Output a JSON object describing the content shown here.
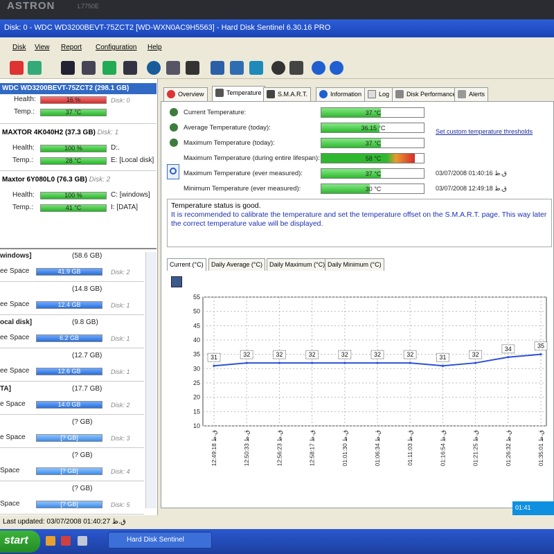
{
  "bezel": {
    "brand": "ASTRON",
    "model": "L7750E"
  },
  "window": {
    "title": "Disk: 0 - WDC WD3200BEVT-75ZCT2 [WD-WXN0AC9H5563] - Hard Disk Sentinel 6.30.16 PRO"
  },
  "menu": [
    "Disk",
    "View",
    "Report",
    "Configuration",
    "Help"
  ],
  "disks": [
    {
      "name": "WDC WD3200BEVT-75ZCT2",
      "size": "(298.1 GB)",
      "health_label": "Health:",
      "health": "16 %",
      "health_level": 0.16,
      "temp_label": "Temp.:",
      "temp": "37 °C",
      "disk": "Disk: 0",
      "drives": []
    },
    {
      "name": "MAXTOR 4K040H2",
      "size": "(37.3 GB)",
      "health_label": "Health:",
      "health": "100 %",
      "health_level": 1.0,
      "temp_label": "Temp.:",
      "temp": "28 °C",
      "disk": "Disk: 1",
      "drives": [
        "D:.",
        "E: [Local disk]"
      ]
    },
    {
      "name": "Maxtor 6Y080L0",
      "size": "(76.3 GB)",
      "health_label": "Health:",
      "health": "100 %",
      "health_level": 1.0,
      "temp_label": "Temp.:",
      "temp": "41 °C",
      "disk": "Disk: 2",
      "drives": [
        "C: [windows]",
        "I: [DATA]"
      ]
    }
  ],
  "volumes": [
    {
      "name": "windows]",
      "size": "(58.6 GB)",
      "free_label": "ee Space",
      "free": "41.9 GB",
      "disk": "Disk: 2"
    },
    {
      "name": "",
      "size": "(14.8 GB)",
      "free_label": "ee Space",
      "free": "12.4 GB",
      "disk": "Disk: 1"
    },
    {
      "name": "ocal disk]",
      "size": "(9.8 GB)",
      "free_label": "ee Space",
      "free": "6.2 GB",
      "disk": "Disk: 1"
    },
    {
      "name": "",
      "size": "(12.7 GB)",
      "free_label": "ee Space",
      "free": "12.6 GB",
      "disk": "Disk: 1"
    },
    {
      "name": "TA]",
      "size": "(17.7 GB)",
      "free_label": "e Space",
      "free": "14.0 GB",
      "disk": "Disk: 2"
    },
    {
      "name": "",
      "size": "(? GB)",
      "free_label": "e Space",
      "free": "[? GB]",
      "disk": "Disk: 3"
    },
    {
      "name": "",
      "size": "(? GB)",
      "free_label": "Space",
      "free": "[? GB]",
      "disk": "Disk: 4"
    },
    {
      "name": "",
      "size": "(? GB)",
      "free_label": "Space",
      "free": "[? GB]",
      "disk": "Disk: 5"
    }
  ],
  "tabs": [
    "Overview",
    "Temperature",
    "S.M.A.R.T.",
    "Information",
    "Log",
    "Disk Performance",
    "Alerts"
  ],
  "temps": [
    {
      "label": "Current Temperature:",
      "value": "37 °C",
      "level": 0.37,
      "stamp": ""
    },
    {
      "label": "Average Temperature (today):",
      "value": "36.15 °C",
      "level": 0.36,
      "stamp": ""
    },
    {
      "label": "Maximum Temperature (today):",
      "value": "37 °C",
      "level": 0.37,
      "stamp": ""
    },
    {
      "label": "Maximum Temperature (during entire lifespan):",
      "value": "58 °C",
      "level": 0.58,
      "stamp": ""
    },
    {
      "label": "Maximum Temperature (ever measured):",
      "value": "37 °C",
      "level": 0.37,
      "stamp": "03/07/2008 01:40:16 ق.ظ"
    },
    {
      "label": "Minimum Temperature (ever measured):",
      "value": "30 °C",
      "level": 0.3,
      "stamp": "03/07/2008 12:49:18 ق.ظ"
    }
  ],
  "thresholds_link": "Set custom temperature thresholds",
  "status_msg": {
    "line1": "Temperature status is good.",
    "line2": "It is recommended to calibrate the temperature and set the temperature offset on the S.M.A.R.T. page. This way later the correct temperature value will be displayed."
  },
  "subtabs": [
    "Current (°C)",
    "Daily Average (°C)",
    "Daily Maximum (°C)",
    "Daily Minimum (°C)"
  ],
  "chart_data": {
    "type": "line",
    "ylim": [
      10,
      55
    ],
    "yticks": [
      10,
      15,
      20,
      25,
      30,
      35,
      40,
      45,
      50,
      55
    ],
    "x": [
      "12:49:18 ق.ظ",
      "12:50:33 ق.ظ",
      "12:56:23 ق.ظ",
      "12:58:17 ق.ظ",
      "01:01:30 ق.ظ",
      "01:06:34 ق.ظ",
      "01:11:03 ق.ظ",
      "01:16:54 ق.ظ",
      "01:21:25 ق.ظ",
      "01:26:32 ق.ظ",
      "01:35:01 ق.ظ"
    ],
    "values": [
      31,
      32,
      32,
      32,
      32,
      32,
      32,
      31,
      32,
      34,
      35
    ],
    "point_labels": [
      "31",
      "32",
      "32",
      "32",
      "32",
      "32",
      "32",
      "31",
      "32",
      "34",
      "35"
    ],
    "grid": true
  },
  "status_bar": "Last updated: 03/07/2008 01:40:27 ق.ظ",
  "tray_time": "01:41",
  "taskbar": {
    "start": "start",
    "task": "Hard Disk Sentinel"
  },
  "colors": {
    "good": "#28b428",
    "bad": "#d52b2b",
    "accent": "#316ac5",
    "line": "#2c50d8"
  }
}
